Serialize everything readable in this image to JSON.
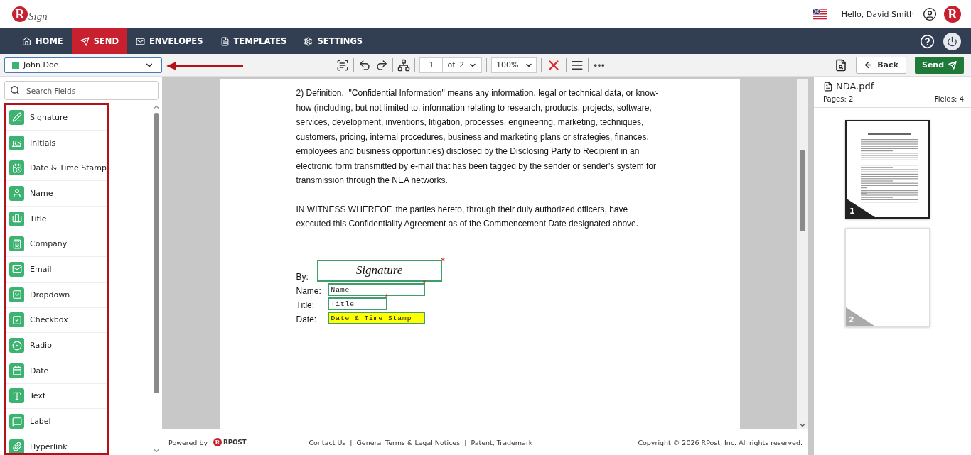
{
  "logo": {
    "mark": "R",
    "word": "Sign"
  },
  "header": {
    "greeting": "Hello, David Smith",
    "avatar": "R"
  },
  "nav": [
    {
      "kind": "home",
      "label": "HOME",
      "selected": false
    },
    {
      "kind": "send",
      "label": "SEND",
      "selected": true
    },
    {
      "kind": "envelopes",
      "label": "ENVELOPES",
      "selected": false
    },
    {
      "kind": "templates",
      "label": "TEMPLATES",
      "selected": false
    },
    {
      "kind": "settings",
      "label": "SETTINGS",
      "selected": false
    }
  ],
  "recipient": {
    "name": "John Doe",
    "color": "#3cb371"
  },
  "toolbar": {
    "page": "1",
    "of": "of",
    "total": "2",
    "zoom": "100%",
    "back": "Back",
    "send": "Send"
  },
  "search": {
    "placeholder": "Search Fields"
  },
  "fields": [
    {
      "kind": "signature",
      "label": "Signature"
    },
    {
      "kind": "initials",
      "label": "Initials",
      "icon_text": "RS"
    },
    {
      "kind": "datetime",
      "label": "Date & Time Stamp"
    },
    {
      "kind": "name",
      "label": "Name"
    },
    {
      "kind": "title",
      "label": "Title"
    },
    {
      "kind": "company",
      "label": "Company"
    },
    {
      "kind": "email",
      "label": "Email"
    },
    {
      "kind": "dropdown",
      "label": "Dropdown"
    },
    {
      "kind": "checkbox",
      "label": "Checkbox"
    },
    {
      "kind": "radio",
      "label": "Radio"
    },
    {
      "kind": "date",
      "label": "Date"
    },
    {
      "kind": "text",
      "label": "Text"
    },
    {
      "kind": "label",
      "label": "Label"
    },
    {
      "kind": "hyperlink",
      "label": "Hyperlink"
    }
  ],
  "document": {
    "paragraphs": [
      "2) Definition.  \"Confidential Information\" means any information, legal or technical data, or know-how (including, but not limited to, information relating to research, products, projects, software, services, development, inventions, litigation, processes, engineering, marketing, techniques, customers, pricing, internal procedures, business and marketing plans or strategies, finances, employees and business opportunities) disclosed by the Disclosing Party to Recipient in an electronic form transmitted by e-mail that has been tagged by the sender or sender's system for transmission through the NEA networks.",
      "IN WITNESS WHEREOF, the parties hereto, through their duly authorized officers, have executed this Confidentiality Agreement as of the Commencement Date designated above."
    ],
    "required_mark": "*",
    "form": [
      {
        "label": "By:",
        "kind": "signature",
        "field": "Signature",
        "required": true,
        "highlighted": false
      },
      {
        "label": "Name:",
        "kind": "text",
        "field": "Name",
        "required": true,
        "highlighted": false
      },
      {
        "label": "Title:",
        "kind": "text",
        "field": "Title",
        "required": true,
        "highlighted": false
      },
      {
        "label": "Date:",
        "kind": "text",
        "field": "Date & Time Stamp",
        "required": false,
        "highlighted": true
      }
    ]
  },
  "footer": {
    "powered": "Powered by",
    "brand_mark": "R",
    "brand": "RPOST",
    "links": [
      "Contact Us",
      "General Terms & Legal Notices",
      "Patent, Trademark"
    ],
    "separator": "|",
    "copyright": "Copyright © 2026 RPost, Inc. All rights reserved."
  },
  "file": {
    "name": "NDA.pdf",
    "pages": "Pages: 2",
    "fields": "Fields: 4"
  },
  "thumbnails": [
    {
      "number": "1",
      "selected": true,
      "kind": "text"
    },
    {
      "number": "2",
      "selected": false,
      "kind": "blank"
    }
  ]
}
